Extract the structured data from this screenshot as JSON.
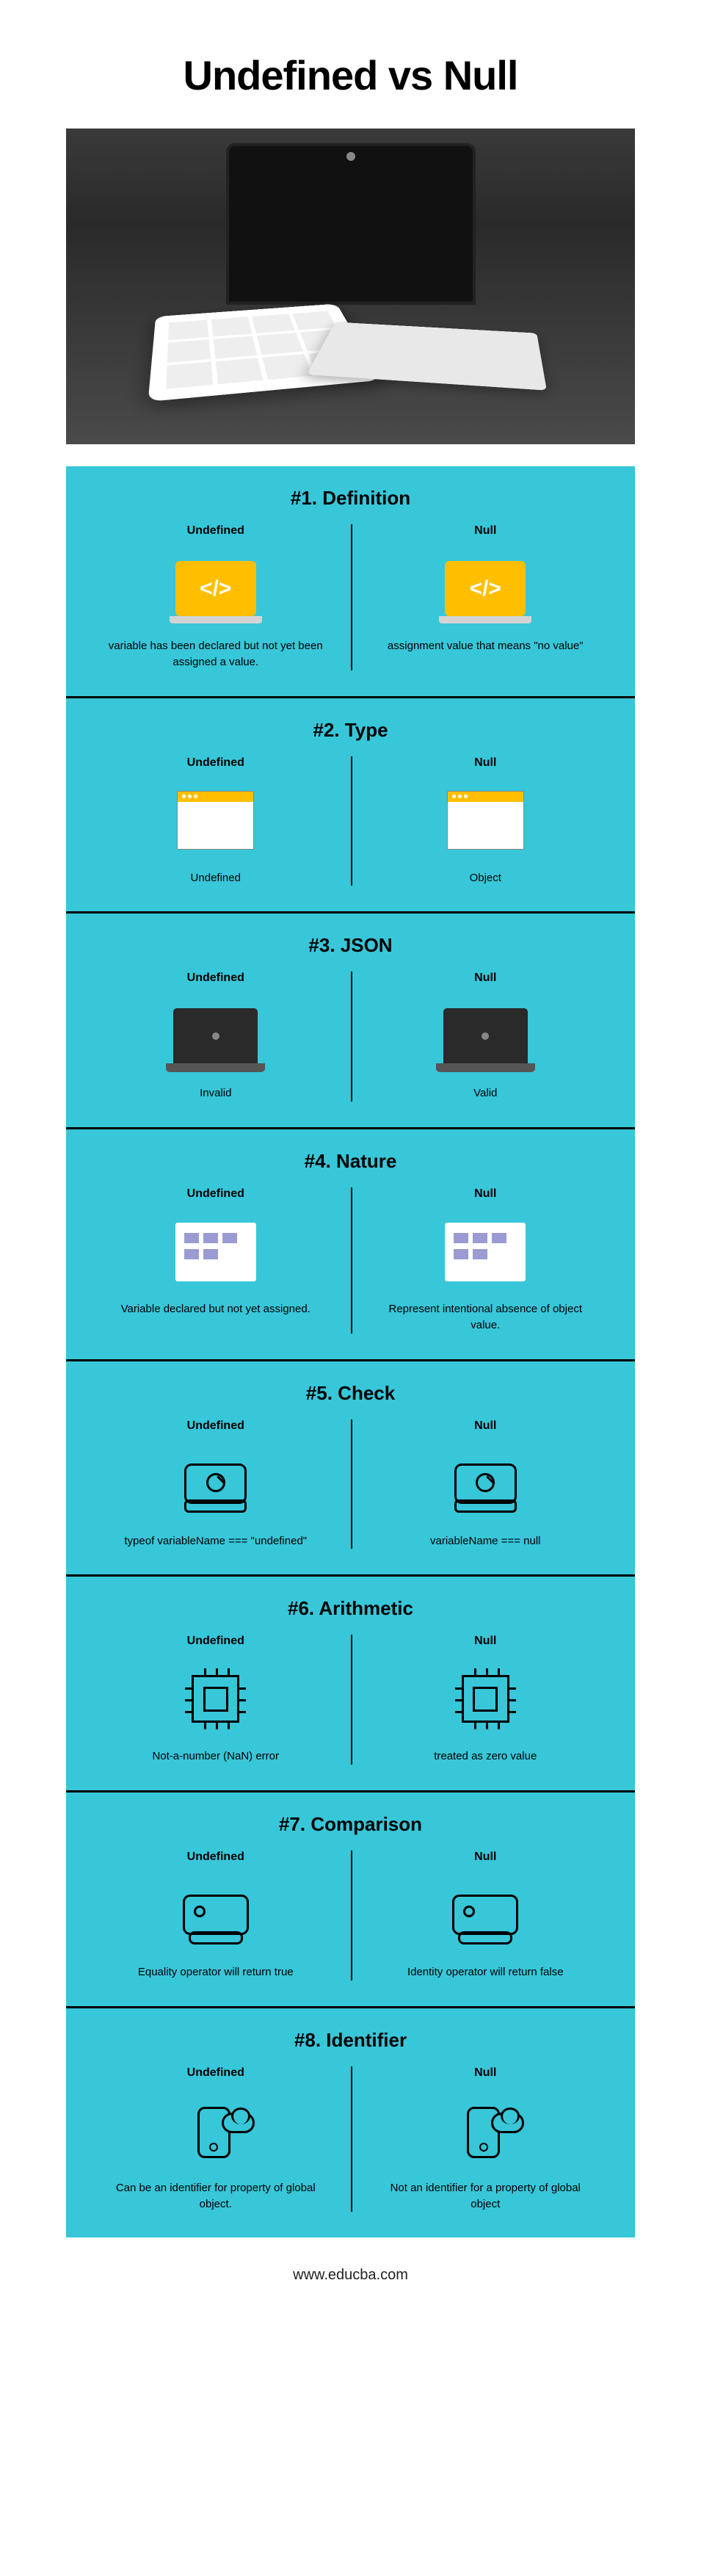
{
  "title": "Undefined vs Null",
  "left_label": "Undefined",
  "right_label": "Null",
  "sections": [
    {
      "heading": "#1. Definition",
      "icon": "ilap",
      "left": "variable has been declared but not yet been assigned a value.",
      "right": "assignment value that means \"no value\""
    },
    {
      "heading": "#2. Type",
      "icon": "iwin",
      "left": "Undefined",
      "right": "Object"
    },
    {
      "heading": "#3. JSON",
      "icon": "inote",
      "left": "Invalid",
      "right": "Valid"
    },
    {
      "heading": "#4. Nature",
      "icon": "ispread",
      "left": "Variable declared but not yet assigned.",
      "right": "Represent intentional absence of object value."
    },
    {
      "heading": "#5. Check",
      "icon": "idrive",
      "left": "typeof variableName === \"undefined\"",
      "right": "variableName === null"
    },
    {
      "heading": "#6. Arithmetic",
      "icon": "ichip",
      "left": "Not-a-number (NaN) error",
      "right": "treated as zero value"
    },
    {
      "heading": "#7. Comparison",
      "icon": "istk",
      "left": "Equality operator will return true",
      "right": "Identity operator will return false"
    },
    {
      "heading": "#8. Identifier",
      "icon": "icloud",
      "left": "Can be an identifier for property of global object.",
      "right": "Not an identifier for a property of global object"
    }
  ],
  "footer": "www.educba.com"
}
